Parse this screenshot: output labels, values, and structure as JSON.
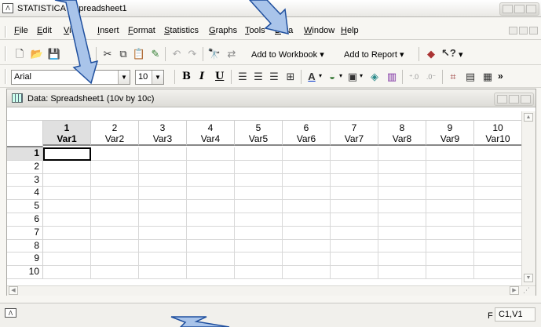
{
  "app": {
    "title": "STATISTICA - Spreadsheet1"
  },
  "menu": {
    "items": [
      "File",
      "Edit",
      "View",
      "Insert",
      "Format",
      "Statistics",
      "Graphs",
      "Tools",
      "Data",
      "Window",
      "Help"
    ]
  },
  "toolbar": {
    "add_to_workbook": "Add to Workbook",
    "add_to_report": "Add to Report"
  },
  "format_toolbar": {
    "font_name": "Arial",
    "font_size": "10",
    "bold": "B",
    "italic": "I",
    "underline": "U"
  },
  "document": {
    "title": "Data: Spreadsheet1 (10v by 10c)",
    "columns": [
      {
        "num": "1",
        "name": "Var1"
      },
      {
        "num": "2",
        "name": "Var2"
      },
      {
        "num": "3",
        "name": "Var3"
      },
      {
        "num": "4",
        "name": "Var4"
      },
      {
        "num": "5",
        "name": "Var5"
      },
      {
        "num": "6",
        "name": "Var6"
      },
      {
        "num": "7",
        "name": "Var7"
      },
      {
        "num": "8",
        "name": "Var8"
      },
      {
        "num": "9",
        "name": "Var9"
      },
      {
        "num": "10",
        "name": "Var10"
      }
    ],
    "rows": [
      "1",
      "2",
      "3",
      "4",
      "5",
      "6",
      "7",
      "8",
      "9",
      "10"
    ],
    "selected_row": 0,
    "selected_col": 0
  },
  "status": {
    "cell_ref": "C1,V1",
    "left_char": "F"
  },
  "colors": {
    "arrow_fill": "#a9c4ea",
    "arrow_stroke": "#1f4f9e",
    "selected_header": "#e0e0e0"
  }
}
